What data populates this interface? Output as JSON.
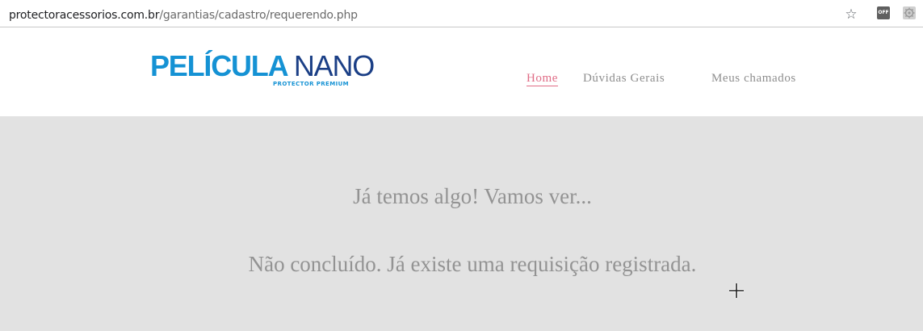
{
  "browser": {
    "url_domain": "protectoracessorios.com.br",
    "url_path": "/garantias/cadastro/requerendo.php",
    "bookmark_icon": "star-icon",
    "extension_off_label": "OFF",
    "extension_icon": "gear-icon"
  },
  "header": {
    "logo": {
      "part1": "PELÍCULA ",
      "part2": "NANO",
      "tagline": "PROTECTOR PREMIUM"
    },
    "nav": [
      {
        "label": "Home",
        "active": true
      },
      {
        "label": "Dúvidas Gerais"
      },
      {
        "label": "Meus chamados"
      }
    ]
  },
  "content": {
    "message_1": "Já temos algo! Vamos ver...",
    "message_2": "Não concluído. Já existe uma requisição registrada."
  },
  "colors": {
    "accent": "#e06c86",
    "logo_blue": "#1592d4",
    "logo_navy": "#1b3f86",
    "content_bg": "#e2e2e2",
    "text_gray": "#939393"
  }
}
